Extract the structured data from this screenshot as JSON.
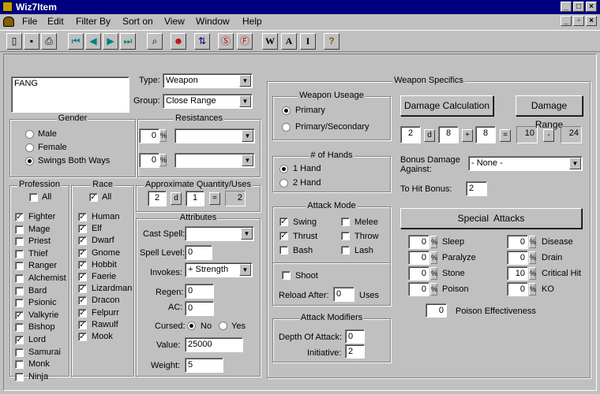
{
  "window": {
    "title": "Wiz7Item"
  },
  "menu": [
    "File",
    "Edit",
    "Filter By",
    "Sort on",
    "View",
    "Window",
    "Help"
  ],
  "toolbar_icons": [
    "new-icon",
    "save-icon",
    "print-icon",
    "first-icon",
    "prev-icon",
    "next-icon",
    "last-icon",
    "find-icon",
    "monster-icon",
    "sort-icon",
    "filter-on-icon",
    "filter-off-icon",
    "w-icon",
    "a-icon",
    "i-icon",
    "help-icon"
  ],
  "toolbar_glyphs": {
    "w": "W",
    "a": "A",
    "i": "I",
    "help": "?"
  },
  "item": {
    "name": "FANG",
    "type_label": "Type:",
    "type_value": "Weapon",
    "group_label": "Group:",
    "group_value": "Close Range"
  },
  "gender": {
    "title": "Gender",
    "options": [
      "Male",
      "Female",
      "Swings Both Ways"
    ],
    "selected": "Swings Both Ways"
  },
  "resistances": {
    "title": "Resistances",
    "rows": [
      {
        "value": "0",
        "pct": "%",
        "type": ""
      },
      {
        "value": "0",
        "pct": "%",
        "type": ""
      }
    ]
  },
  "profession": {
    "title": "Profession",
    "all_label": "All",
    "items": [
      {
        "name": "Fighter",
        "checked": true
      },
      {
        "name": "Mage",
        "checked": false
      },
      {
        "name": "Priest",
        "checked": false
      },
      {
        "name": "Thief",
        "checked": false
      },
      {
        "name": "Ranger",
        "checked": false
      },
      {
        "name": "Alchemist",
        "checked": false
      },
      {
        "name": "Bard",
        "checked": false
      },
      {
        "name": "Psionic",
        "checked": false
      },
      {
        "name": "Valkyrie",
        "checked": true
      },
      {
        "name": "Bishop",
        "checked": false
      },
      {
        "name": "Lord",
        "checked": true
      },
      {
        "name": "Samurai",
        "checked": false
      },
      {
        "name": "Monk",
        "checked": false
      },
      {
        "name": "Ninja",
        "checked": false
      }
    ]
  },
  "race": {
    "title": "Race",
    "all_label": "All",
    "all_checked": true,
    "items": [
      {
        "name": "Human",
        "checked": true
      },
      {
        "name": "Elf",
        "checked": true
      },
      {
        "name": "Dwarf",
        "checked": true
      },
      {
        "name": "Gnome",
        "checked": true
      },
      {
        "name": "Hobbit",
        "checked": true
      },
      {
        "name": "Faerie",
        "checked": true
      },
      {
        "name": "Lizardman",
        "checked": true
      },
      {
        "name": "Dracon",
        "checked": true
      },
      {
        "name": "Felpurr",
        "checked": true
      },
      {
        "name": "Rawulf",
        "checked": true
      },
      {
        "name": "Mook",
        "checked": true
      }
    ]
  },
  "quantity": {
    "title": "Approximate Quantity/Uses",
    "dice": "2",
    "d": "d",
    "sides": "1",
    "eq": "=",
    "result": "2"
  },
  "attributes": {
    "title": "Attributes",
    "cast_spell_label": "Cast Spell:",
    "cast_spell_value": "",
    "spell_level_label": "Spell Level:",
    "spell_level_value": "0",
    "invokes_label": "Invokes:",
    "invokes_value": "+ Strength",
    "regen_label": "Regen:",
    "regen_value": "0",
    "ac_label": "AC:",
    "ac_value": "0",
    "cursed_label": "Cursed:",
    "cursed_no": "No",
    "cursed_yes": "Yes",
    "value_label": "Value:",
    "value_value": "25000",
    "weight_label": "Weight:",
    "weight_value": "5"
  },
  "weapon": {
    "title": "Weapon Specifics",
    "useage": {
      "title": "Weapon Useage",
      "primary": "Primary",
      "primary_secondary": "Primary/Secondary"
    },
    "hands": {
      "title": "# of Hands",
      "one": "1 Hand",
      "two": "2 Hand"
    },
    "attack_mode": {
      "title": "Attack Mode",
      "swing": "Swing",
      "thrust": "Thrust",
      "bash": "Bash",
      "melee": "Melee",
      "throw": "Throw",
      "lash": "Lash",
      "shoot": "Shoot",
      "reload_label": "Reload After:",
      "reload_value": "0",
      "uses": "Uses"
    },
    "modifiers": {
      "title": "Attack Modifiers",
      "depth_label": "Depth Of Attack:",
      "depth_value": "0",
      "init_label": "Initiative:",
      "init_value": "2"
    },
    "damage_calc_button": "Damage Calculation",
    "damage_range_button": "Damage Range",
    "damage": {
      "dice": "2",
      "d": "d",
      "sides": "8",
      "plus": "+",
      "bonus": "8",
      "eq": "=",
      "min": "10",
      "dash": "-",
      "max": "24"
    },
    "bonus_damage_label_1": "Bonus Damage",
    "bonus_damage_label_2": "Against:",
    "bonus_damage_value": "- None -",
    "to_hit_label": "To Hit Bonus:",
    "to_hit_value": "2",
    "special_attacks_button": "Special  Attacks",
    "specials_left": [
      {
        "value": "0",
        "name": "Sleep"
      },
      {
        "value": "0",
        "name": "Paralyze"
      },
      {
        "value": "0",
        "name": "Stone"
      },
      {
        "value": "0",
        "name": "Poison"
      }
    ],
    "specials_right": [
      {
        "value": "0",
        "name": "Disease"
      },
      {
        "value": "0",
        "name": "Drain"
      },
      {
        "value": "10",
        "name": "Critical Hit"
      },
      {
        "value": "0",
        "name": "KO"
      }
    ],
    "pct": "%",
    "poison_eff_value": "0",
    "poison_eff_label": "Poison Effectiveness"
  }
}
